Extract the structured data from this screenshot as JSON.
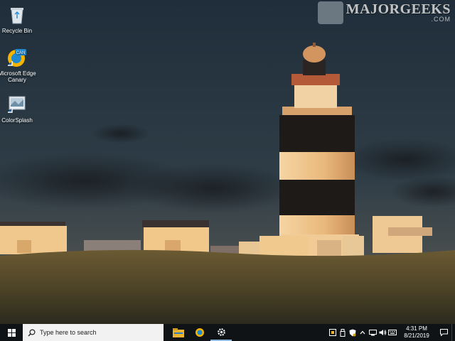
{
  "watermark": {
    "text": "MAJORGEEKS",
    "sub": ".COM"
  },
  "desktop": {
    "icons": [
      {
        "label": "Recycle Bin",
        "icon": "recycle-bin-icon"
      },
      {
        "label": "Microsoft Edge Canary",
        "icon": "edge-canary-icon"
      },
      {
        "label": "ColorSplash",
        "icon": "colorsplash-icon"
      }
    ]
  },
  "taskbar": {
    "start_icon": "windows-logo-icon",
    "search_placeholder": "Type here to search",
    "apps": [
      {
        "name": "File Explorer",
        "icon": "file-explorer-icon"
      },
      {
        "name": "Microsoft Edge Canary",
        "icon": "edge-canary-icon"
      },
      {
        "name": "Settings",
        "icon": "gear-icon"
      }
    ],
    "tray_icons": [
      "tray-app-icon",
      "usb-icon",
      "security-shield-icon",
      "chevron-up-icon",
      "network-icon",
      "volume-icon",
      "keyboard-icon"
    ],
    "time": "4:31 PM",
    "date": "8/21/2019",
    "notification_icon": "notification-icon"
  },
  "colors": {
    "taskbar": "#0f1316",
    "search_box": "#f2f2f2",
    "accent": "#8fb9e0"
  }
}
